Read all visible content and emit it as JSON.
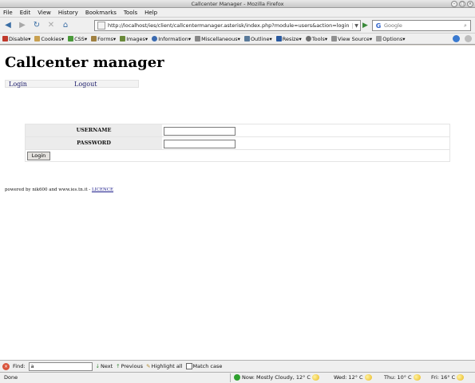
{
  "window": {
    "title": "Callcenter Manager - Mozilla Firefox"
  },
  "menu": {
    "items": [
      "File",
      "Edit",
      "View",
      "History",
      "Bookmarks",
      "Tools",
      "Help"
    ]
  },
  "nav": {
    "url": "http://localhost/ies/client/callcentermanager.asterisk/index.php?module=users&action=login",
    "search_placeholder": "Google"
  },
  "devtoolbar": {
    "items": [
      "Disable▾",
      "Cookies▾",
      "CSS▾",
      "Forms▾",
      "Images▾",
      "Information▾",
      "Miscellaneous▾",
      "Outline▾",
      "Resize▾",
      "Tools▾",
      "View Source▾",
      "Options▾"
    ],
    "icon_colors": [
      "#c0392b",
      "#c8a050",
      "#4a9a3a",
      "#a08040",
      "#6a8a3a",
      "#3a6ab0",
      "#888888",
      "#5a7a9a",
      "#2a5aa0",
      "#707070",
      "#909090",
      "#a0a0a0"
    ]
  },
  "page": {
    "heading": "Callcenter manager",
    "links": {
      "login": "Login",
      "logout": "Logout"
    },
    "form": {
      "username_label": "USERNAME",
      "password_label": "PASSWORD",
      "username_value": "",
      "password_value": "",
      "submit_label": "Login"
    },
    "footer": {
      "text": "powered by nik600 and www.ies.tn.it - ",
      "license": "LICENCE"
    }
  },
  "findbar": {
    "label": "Find:",
    "query": "a",
    "next": "Next",
    "previous": "Previous",
    "highlight": "Highlight all",
    "match_case": "Match case"
  },
  "status": {
    "text": "Done",
    "weather_now": "Now: Mostly Cloudy, 12° C",
    "weather_wed": "Wed: 12° C",
    "weather_thu": "Thu: 10° C",
    "weather_fri": "Fri: 16° C"
  }
}
